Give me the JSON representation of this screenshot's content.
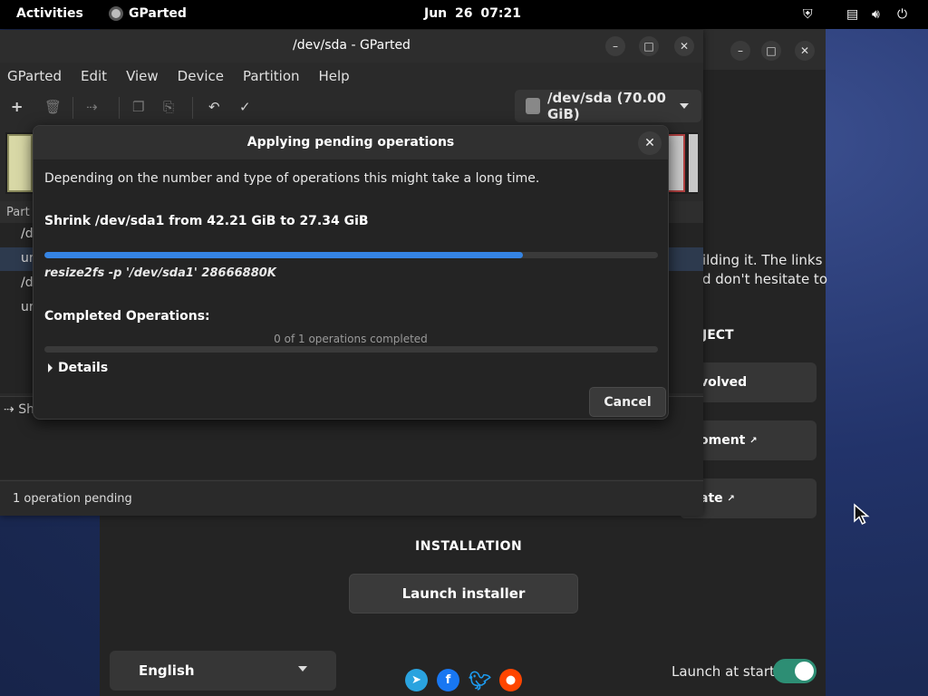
{
  "topbar": {
    "activities": "Activities",
    "app_name": "GParted",
    "clock": "Jun 26  07:21",
    "icons": [
      "shield-icon",
      "keyboard-icon",
      "volume-icon",
      "power-icon"
    ]
  },
  "welcome": {
    "text_line1": "ilding it. The links",
    "text_line2": "d don't hesitate to",
    "project_heading": "JECT",
    "btn_involved": "volved",
    "btn_development": "oment",
    "btn_donate": "ate",
    "installation_heading": "INSTALLATION",
    "launch_installer": "Launch installer",
    "language": "English",
    "launch_at_start": "Launch at start",
    "launch_at_start_enabled": true,
    "social": [
      "telegram-icon",
      "facebook-icon",
      "twitter-icon",
      "reddit-icon"
    ]
  },
  "gparted": {
    "title": "/dev/sda - GParted",
    "menu": [
      "GParted",
      "Edit",
      "View",
      "Device",
      "Partition",
      "Help"
    ],
    "device": "/dev/sda (70.00 GiB)",
    "table_header": "Part",
    "rows": [
      "/d",
      "ur",
      "/d",
      "ur"
    ],
    "pending_op_prefix": "Sh",
    "status": "1 operation pending"
  },
  "dialog": {
    "title": "Applying pending operations",
    "description": "Depending on the number and type of operations this might take a long time.",
    "operation": "Shrink /dev/sda1 from 42.21 GiB to 27.34 GiB",
    "operation_progress": 0.78,
    "command": "resize2fs -p '/dev/sda1' 28666880K",
    "completed_label": "Completed Operations:",
    "completed_count": "0 of 1 operations completed",
    "completed_progress": 0,
    "details": "Details",
    "cancel": "Cancel"
  }
}
